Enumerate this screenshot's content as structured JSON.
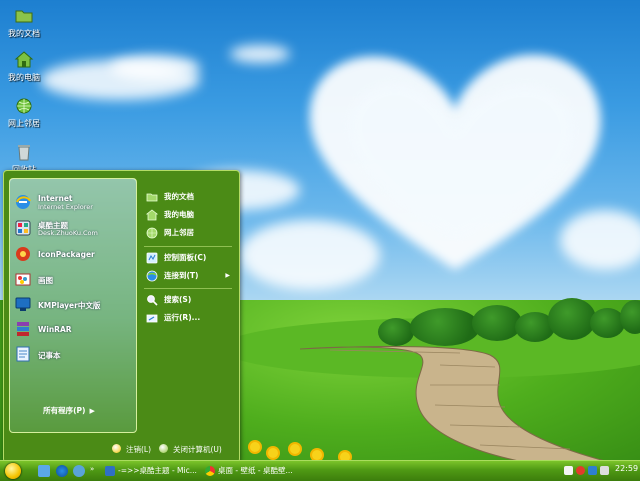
{
  "desktop": {
    "icons": [
      {
        "label": "我的文档",
        "icon": "folder-icon"
      },
      {
        "label": "我的电脑",
        "icon": "computer-icon"
      },
      {
        "label": "网上邻居",
        "icon": "network-icon"
      },
      {
        "label": "回收站",
        "icon": "recycle-bin-icon"
      }
    ]
  },
  "start_menu": {
    "pinned": [
      {
        "title": "Internet",
        "subtitle": "Internet Explorer",
        "icon": "internet-explorer-icon"
      },
      {
        "title": "桌酷主题",
        "subtitle": "Desk.ZhuoKu.Com",
        "icon": "zhuoku-icon"
      }
    ],
    "recent": [
      {
        "title": "IconPackager",
        "icon": "iconpackager-icon"
      },
      {
        "title": "画图",
        "icon": "paint-icon"
      },
      {
        "title": "KMPlayer中文版",
        "icon": "kmplayer-icon"
      },
      {
        "title": "WinRAR",
        "icon": "winrar-icon"
      },
      {
        "title": "记事本",
        "icon": "notepad-icon"
      }
    ],
    "all_programs": "所有程序(P)",
    "right": {
      "docs": "我的文档",
      "computer": "我的电脑",
      "network": "网上邻居",
      "control_panel": "控制面板(C)",
      "connect_to": "连接到(T)",
      "search": "搜索(S)",
      "run": "运行(R)..."
    },
    "logoff": "注销(L)",
    "shutdown": "关闭计算机(U)"
  },
  "taskbar": {
    "tasks": [
      {
        "label": "-=>>桌酷主题 - Mic...",
        "icon": "word-icon"
      },
      {
        "label": "桌面 - 壁纸 - 桌酷壁...",
        "icon": "chrome-icon"
      }
    ],
    "clock": "22:59"
  },
  "colors": {
    "menu_green": "#4b8b16",
    "taskbar_green": "#4f9914",
    "border_light": "#b4dc66"
  }
}
